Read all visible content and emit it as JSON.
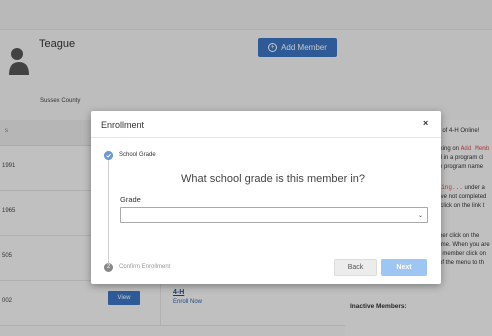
{
  "background": {
    "member_name": "Teague",
    "county": "Sussex County",
    "add_member_label": "Add Member",
    "rows": [
      {
        "year": "1991"
      },
      {
        "year": "1965"
      },
      {
        "year": "505"
      },
      {
        "year": "002",
        "view_label": "View",
        "club": "4-H",
        "enroll_label": "Enroll Now"
      }
    ],
    "side_text": {
      "line1": "on of 4-H Online!",
      "line2a": "licking on ",
      "line2b": "Add Memb",
      "line3": "roll in a program cl",
      "line4": "the program name",
      "line5a": "lling...",
      "line5b": " under a",
      "line6": "have not completed",
      "line7": "st click on the link t",
      "line8a": "mber click on the ",
      "line9": "name. When you are",
      "line10": "ed member click on",
      "line11": "p of the menu to th"
    },
    "inactive_label": "Inactive Members:"
  },
  "modal": {
    "title": "Enrollment",
    "close_glyph": "×",
    "step1": {
      "number": "1",
      "label": "School Grade"
    },
    "step2": {
      "number": "2",
      "label": "Confirm Enrollment"
    },
    "question": "What school grade is this member in?",
    "grade_label": "Grade",
    "grade_value": "",
    "back_label": "Back",
    "next_label": "Next"
  },
  "colors": {
    "primary": "#3c75c3",
    "next_disabled": "#9ec6f2",
    "step_active": "#6a9ad6"
  }
}
